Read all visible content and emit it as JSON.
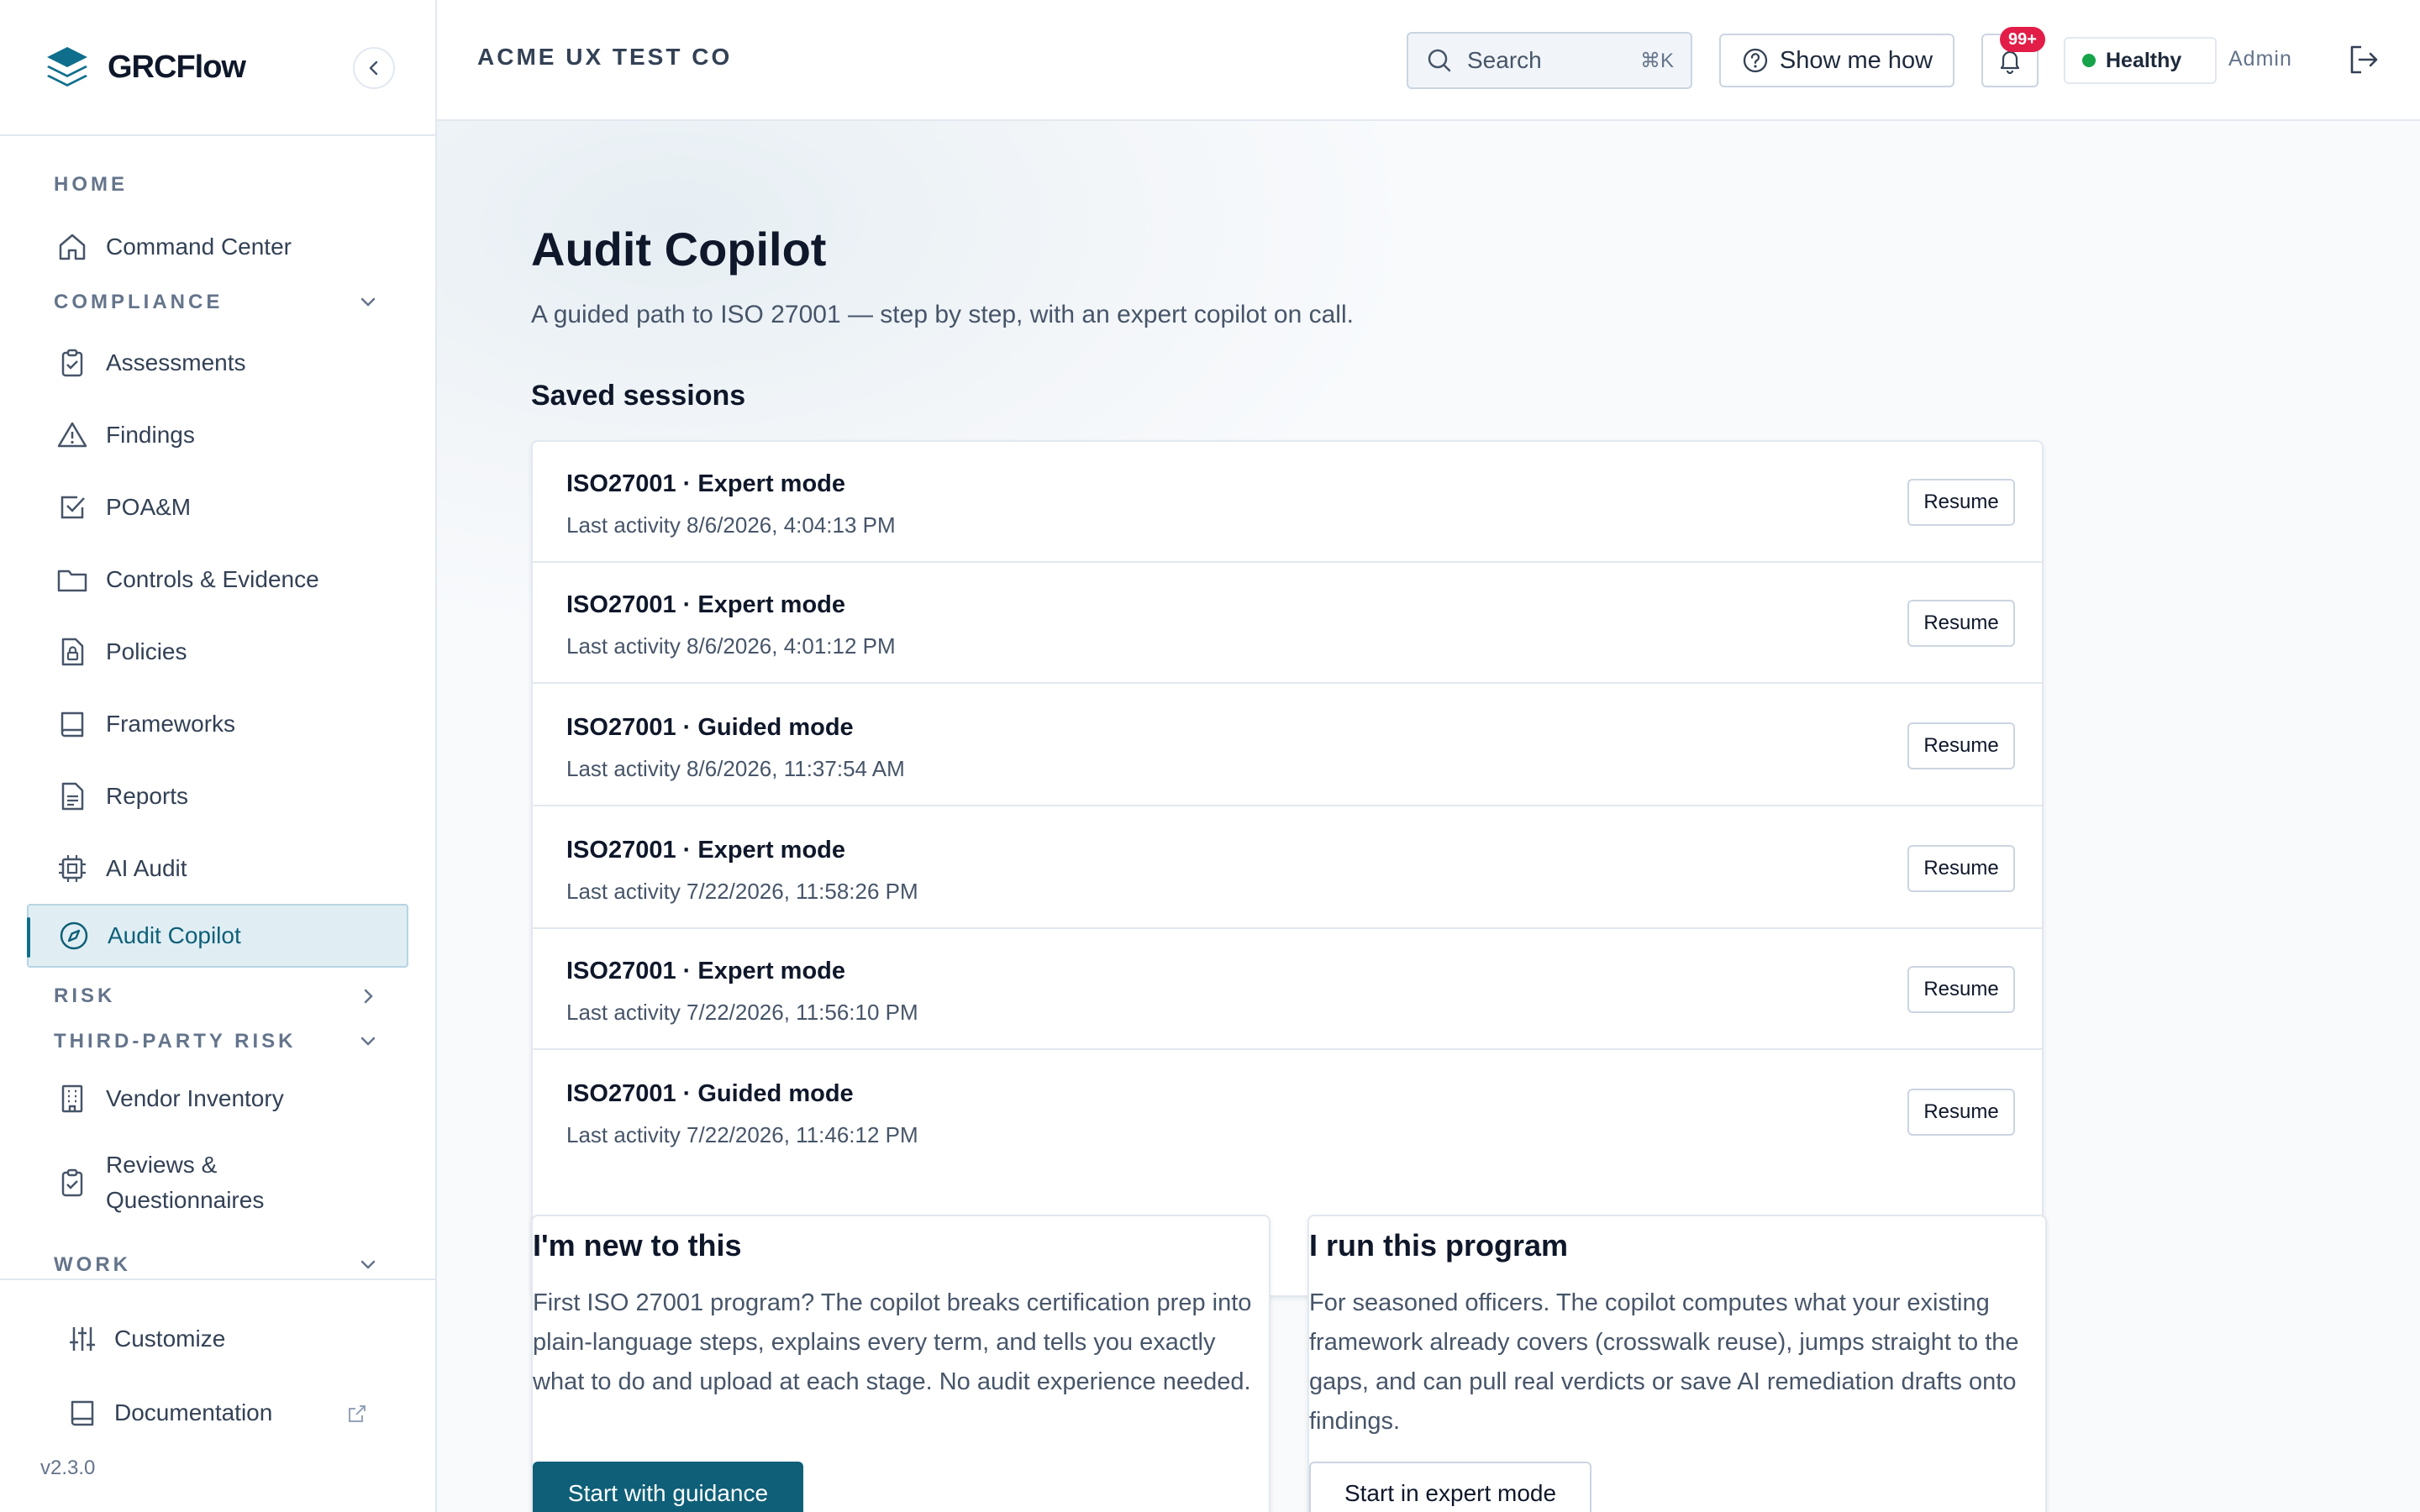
{
  "brand": {
    "name": "GRCFlow",
    "collapse_icon": "chevron-left-icon"
  },
  "sidebar": {
    "home_label": "HOME",
    "compliance_label": "COMPLIANCE",
    "risk_label": "RISK",
    "third_party_label": "THIRD-PARTY RISK",
    "work_label": "WORK",
    "items": {
      "command_center": "Command Center",
      "assessments": "Assessments",
      "findings": "Findings",
      "poam": "POA&M",
      "controls": "Controls & Evidence",
      "policies": "Policies",
      "frameworks": "Frameworks",
      "reports": "Reports",
      "ai_audit": "AI Audit",
      "audit_copilot": "Audit Copilot",
      "vendor_inventory": "Vendor Inventory",
      "reviews_line1": "Reviews &",
      "reviews_line2": "Questionnaires"
    },
    "footer": {
      "customize": "Customize",
      "documentation": "Documentation",
      "version": "v2.3.0"
    }
  },
  "topbar": {
    "org": "ACME UX TEST CO",
    "search_placeholder": "Search",
    "search_shortcut": "⌘K",
    "show_me_how": "Show me how",
    "notifications_badge": "99+",
    "health_status": "Healthy",
    "user_role": "Admin"
  },
  "page": {
    "title": "Audit Copilot",
    "subtitle": "A guided path to ISO 27001 — step by step, with an expert copilot on call.",
    "sessions_heading": "Saved sessions",
    "resume_label": "Resume",
    "sessions": [
      {
        "title": "ISO27001 · Expert mode",
        "meta": "Last activity 8/6/2026, 4:04:13 PM"
      },
      {
        "title": "ISO27001 · Expert mode",
        "meta": "Last activity 8/6/2026, 4:01:12 PM"
      },
      {
        "title": "ISO27001 · Guided mode",
        "meta": "Last activity 8/6/2026, 11:37:54 AM"
      },
      {
        "title": "ISO27001 · Expert mode",
        "meta": "Last activity 7/22/2026, 11:58:26 PM"
      },
      {
        "title": "ISO27001 · Expert mode",
        "meta": "Last activity 7/22/2026, 11:56:10 PM"
      },
      {
        "title": "ISO27001 · Guided mode",
        "meta": "Last activity 7/22/2026, 11:46:12 PM"
      }
    ],
    "cards": {
      "new": {
        "title": "I'm new to this",
        "body": "First ISO 27001 program? The copilot breaks certification prep into plain-language steps, explains every term, and tells you exactly what to do and upload at each stage. No audit experience needed.",
        "button": "Start with guidance"
      },
      "expert": {
        "title": "I run this program",
        "body": "For seasoned officers. The copilot computes what your existing framework already covers (crosswalk reuse), jumps straight to the gaps, and can pull real verdicts or save AI remediation drafts onto findings.",
        "button": "Start in expert mode"
      }
    }
  },
  "colors": {
    "accent": "#0f5f78",
    "active_bg": "#e0eef4",
    "badge": "#e11d48",
    "healthy": "#16a34a"
  }
}
